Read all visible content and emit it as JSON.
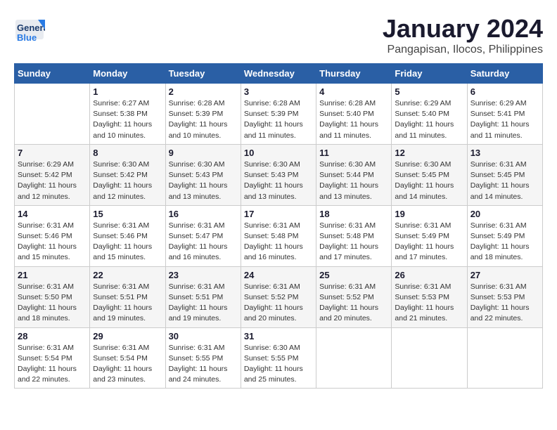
{
  "header": {
    "logo_line1": "General",
    "logo_line2": "Blue",
    "title": "January 2024",
    "subtitle": "Pangapisan, Ilocos, Philippines"
  },
  "weekdays": [
    "Sunday",
    "Monday",
    "Tuesday",
    "Wednesday",
    "Thursday",
    "Friday",
    "Saturday"
  ],
  "weeks": [
    [
      {
        "day": "",
        "sunrise": "",
        "sunset": "",
        "daylight": ""
      },
      {
        "day": "1",
        "sunrise": "Sunrise: 6:27 AM",
        "sunset": "Sunset: 5:38 PM",
        "daylight": "Daylight: 11 hours and 10 minutes."
      },
      {
        "day": "2",
        "sunrise": "Sunrise: 6:28 AM",
        "sunset": "Sunset: 5:39 PM",
        "daylight": "Daylight: 11 hours and 10 minutes."
      },
      {
        "day": "3",
        "sunrise": "Sunrise: 6:28 AM",
        "sunset": "Sunset: 5:39 PM",
        "daylight": "Daylight: 11 hours and 11 minutes."
      },
      {
        "day": "4",
        "sunrise": "Sunrise: 6:28 AM",
        "sunset": "Sunset: 5:40 PM",
        "daylight": "Daylight: 11 hours and 11 minutes."
      },
      {
        "day": "5",
        "sunrise": "Sunrise: 6:29 AM",
        "sunset": "Sunset: 5:40 PM",
        "daylight": "Daylight: 11 hours and 11 minutes."
      },
      {
        "day": "6",
        "sunrise": "Sunrise: 6:29 AM",
        "sunset": "Sunset: 5:41 PM",
        "daylight": "Daylight: 11 hours and 11 minutes."
      }
    ],
    [
      {
        "day": "7",
        "sunrise": "Sunrise: 6:29 AM",
        "sunset": "Sunset: 5:42 PM",
        "daylight": "Daylight: 11 hours and 12 minutes."
      },
      {
        "day": "8",
        "sunrise": "Sunrise: 6:30 AM",
        "sunset": "Sunset: 5:42 PM",
        "daylight": "Daylight: 11 hours and 12 minutes."
      },
      {
        "day": "9",
        "sunrise": "Sunrise: 6:30 AM",
        "sunset": "Sunset: 5:43 PM",
        "daylight": "Daylight: 11 hours and 13 minutes."
      },
      {
        "day": "10",
        "sunrise": "Sunrise: 6:30 AM",
        "sunset": "Sunset: 5:43 PM",
        "daylight": "Daylight: 11 hours and 13 minutes."
      },
      {
        "day": "11",
        "sunrise": "Sunrise: 6:30 AM",
        "sunset": "Sunset: 5:44 PM",
        "daylight": "Daylight: 11 hours and 13 minutes."
      },
      {
        "day": "12",
        "sunrise": "Sunrise: 6:30 AM",
        "sunset": "Sunset: 5:45 PM",
        "daylight": "Daylight: 11 hours and 14 minutes."
      },
      {
        "day": "13",
        "sunrise": "Sunrise: 6:31 AM",
        "sunset": "Sunset: 5:45 PM",
        "daylight": "Daylight: 11 hours and 14 minutes."
      }
    ],
    [
      {
        "day": "14",
        "sunrise": "Sunrise: 6:31 AM",
        "sunset": "Sunset: 5:46 PM",
        "daylight": "Daylight: 11 hours and 15 minutes."
      },
      {
        "day": "15",
        "sunrise": "Sunrise: 6:31 AM",
        "sunset": "Sunset: 5:46 PM",
        "daylight": "Daylight: 11 hours and 15 minutes."
      },
      {
        "day": "16",
        "sunrise": "Sunrise: 6:31 AM",
        "sunset": "Sunset: 5:47 PM",
        "daylight": "Daylight: 11 hours and 16 minutes."
      },
      {
        "day": "17",
        "sunrise": "Sunrise: 6:31 AM",
        "sunset": "Sunset: 5:48 PM",
        "daylight": "Daylight: 11 hours and 16 minutes."
      },
      {
        "day": "18",
        "sunrise": "Sunrise: 6:31 AM",
        "sunset": "Sunset: 5:48 PM",
        "daylight": "Daylight: 11 hours and 17 minutes."
      },
      {
        "day": "19",
        "sunrise": "Sunrise: 6:31 AM",
        "sunset": "Sunset: 5:49 PM",
        "daylight": "Daylight: 11 hours and 17 minutes."
      },
      {
        "day": "20",
        "sunrise": "Sunrise: 6:31 AM",
        "sunset": "Sunset: 5:49 PM",
        "daylight": "Daylight: 11 hours and 18 minutes."
      }
    ],
    [
      {
        "day": "21",
        "sunrise": "Sunrise: 6:31 AM",
        "sunset": "Sunset: 5:50 PM",
        "daylight": "Daylight: 11 hours and 18 minutes."
      },
      {
        "day": "22",
        "sunrise": "Sunrise: 6:31 AM",
        "sunset": "Sunset: 5:51 PM",
        "daylight": "Daylight: 11 hours and 19 minutes."
      },
      {
        "day": "23",
        "sunrise": "Sunrise: 6:31 AM",
        "sunset": "Sunset: 5:51 PM",
        "daylight": "Daylight: 11 hours and 19 minutes."
      },
      {
        "day": "24",
        "sunrise": "Sunrise: 6:31 AM",
        "sunset": "Sunset: 5:52 PM",
        "daylight": "Daylight: 11 hours and 20 minutes."
      },
      {
        "day": "25",
        "sunrise": "Sunrise: 6:31 AM",
        "sunset": "Sunset: 5:52 PM",
        "daylight": "Daylight: 11 hours and 20 minutes."
      },
      {
        "day": "26",
        "sunrise": "Sunrise: 6:31 AM",
        "sunset": "Sunset: 5:53 PM",
        "daylight": "Daylight: 11 hours and 21 minutes."
      },
      {
        "day": "27",
        "sunrise": "Sunrise: 6:31 AM",
        "sunset": "Sunset: 5:53 PM",
        "daylight": "Daylight: 11 hours and 22 minutes."
      }
    ],
    [
      {
        "day": "28",
        "sunrise": "Sunrise: 6:31 AM",
        "sunset": "Sunset: 5:54 PM",
        "daylight": "Daylight: 11 hours and 22 minutes."
      },
      {
        "day": "29",
        "sunrise": "Sunrise: 6:31 AM",
        "sunset": "Sunset: 5:54 PM",
        "daylight": "Daylight: 11 hours and 23 minutes."
      },
      {
        "day": "30",
        "sunrise": "Sunrise: 6:31 AM",
        "sunset": "Sunset: 5:55 PM",
        "daylight": "Daylight: 11 hours and 24 minutes."
      },
      {
        "day": "31",
        "sunrise": "Sunrise: 6:30 AM",
        "sunset": "Sunset: 5:55 PM",
        "daylight": "Daylight: 11 hours and 25 minutes."
      },
      {
        "day": "",
        "sunrise": "",
        "sunset": "",
        "daylight": ""
      },
      {
        "day": "",
        "sunrise": "",
        "sunset": "",
        "daylight": ""
      },
      {
        "day": "",
        "sunrise": "",
        "sunset": "",
        "daylight": ""
      }
    ]
  ]
}
